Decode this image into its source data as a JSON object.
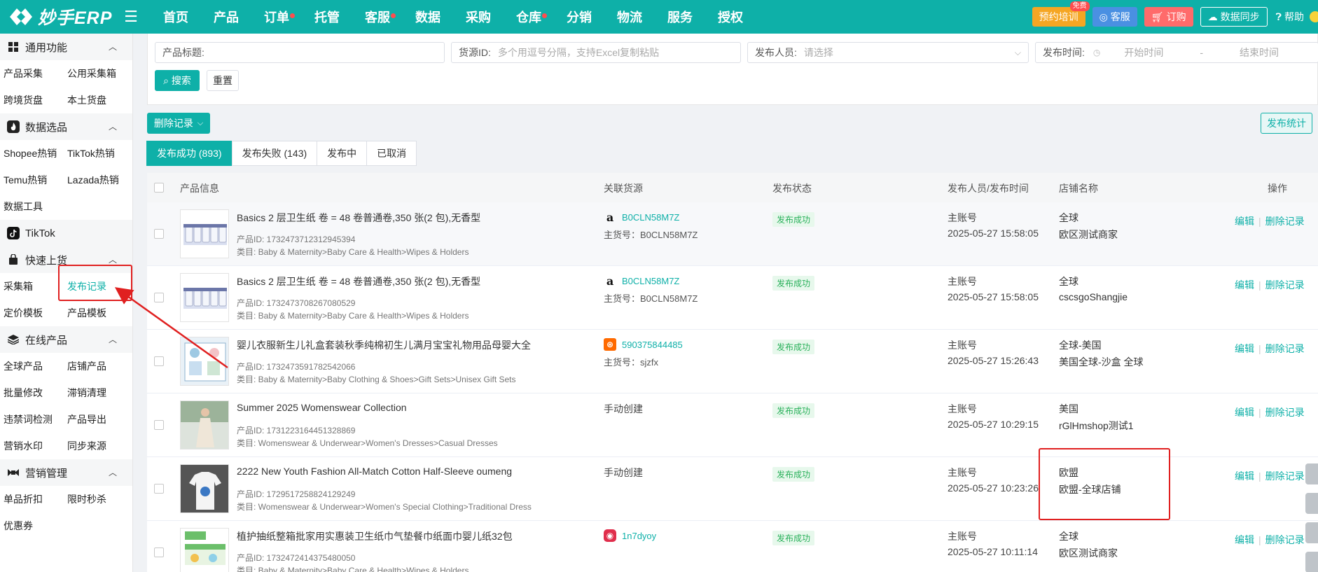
{
  "brand": {
    "logo_text": "妙手ERP"
  },
  "topnav": {
    "items": [
      {
        "label": "首页",
        "dot": false
      },
      {
        "label": "产品",
        "dot": false
      },
      {
        "label": "订单",
        "dot": true
      },
      {
        "label": "托管",
        "dot": false
      },
      {
        "label": "客服",
        "dot": true
      },
      {
        "label": "数据",
        "dot": false
      },
      {
        "label": "采购",
        "dot": false
      },
      {
        "label": "仓库",
        "dot": true
      },
      {
        "label": "分销",
        "dot": false
      },
      {
        "label": "物流",
        "dot": false
      },
      {
        "label": "服务",
        "dot": false
      },
      {
        "label": "授权",
        "dot": false
      }
    ],
    "train_label": "预约培训",
    "free_label": "免费",
    "service_label": "客服",
    "order_label": "订购",
    "sync_label": "数据同步",
    "help_label": "帮助"
  },
  "sidebar": {
    "groups": [
      {
        "title": "通用功能",
        "icon": "grid-icon",
        "rows": [
          [
            "产品采集",
            "公用采集箱"
          ],
          [
            "跨境货盘",
            "本土货盘"
          ]
        ]
      },
      {
        "title": "数据选品",
        "icon": "flame-icon",
        "rows": [
          [
            "Shopee热销",
            "TikTok热销"
          ],
          [
            "Temu热销",
            "Lazada热销"
          ],
          [
            "数据工具"
          ]
        ]
      },
      {
        "title": "TikTok",
        "icon": "tiktok-icon",
        "rows": []
      },
      {
        "title": "快速上货",
        "icon": "bag-icon",
        "rows": [
          [
            "采集箱",
            "发布记录"
          ],
          [
            "定价模板",
            "产品模板"
          ]
        ]
      },
      {
        "title": "在线产品",
        "icon": "stack-icon",
        "rows": [
          [
            "全球产品",
            "店铺产品"
          ],
          [
            "批量修改",
            "滞销清理"
          ],
          [
            "违禁词检测",
            "产品导出"
          ],
          [
            "营销水印",
            "同步来源"
          ]
        ]
      },
      {
        "title": "营销管理",
        "icon": "ribbon-icon",
        "rows": [
          [
            "单品折扣",
            "限时秒杀"
          ],
          [
            "优惠券"
          ]
        ]
      }
    ],
    "active_item": "发布记录"
  },
  "search": {
    "title_label": "产品标题:",
    "source_label": "货源ID:",
    "source_placeholder": "多个用逗号分隔，支持Excel复制粘贴",
    "publisher_label": "发布人员:",
    "publisher_placeholder": "请选择",
    "time_label": "发布时间:",
    "start_placeholder": "开始时间",
    "dash": "-",
    "end_placeholder": "结束时间",
    "search_btn": "搜索",
    "reset_btn": "重置"
  },
  "actions": {
    "delete_records": "删除记录",
    "publish_stats": "发布统计"
  },
  "tabs": [
    {
      "label": "发布成功 (893)",
      "active": true
    },
    {
      "label": "发布失败 (143)",
      "active": false
    },
    {
      "label": "发布中",
      "active": false
    },
    {
      "label": "已取消",
      "active": false
    }
  ],
  "table": {
    "headers": {
      "product": "产品信息",
      "source": "关联货源",
      "status": "发布状态",
      "publisher": "发布人员/发布时间",
      "store": "店铺名称",
      "ops": "操作"
    },
    "rows": [
      {
        "title": "Basics 2 层卫生纸 卷 = 48 卷普通卷,350 张(2 包),无香型",
        "pid": "产品ID: 1732473712312945394",
        "cat": "类目: Baby & Maternity>Baby Care & Health>Wipes & Holders",
        "src_type": "amazon",
        "src_link": "B0CLN58M7Z",
        "src_main": "主货号：B0CLN58M7Z",
        "status": "发布成功",
        "publisher": "主账号",
        "time": "2025-05-27 15:58:05",
        "store1": "全球",
        "store2": "欧区测试商家",
        "thumb": "tissue"
      },
      {
        "title": "Basics 2 层卫生纸 卷 = 48 卷普通卷,350 张(2 包),无香型",
        "pid": "产品ID: 1732473708267080529",
        "cat": "类目: Baby & Maternity>Baby Care & Health>Wipes & Holders",
        "src_type": "amazon",
        "src_link": "B0CLN58M7Z",
        "src_main": "主货号：B0CLN58M7Z",
        "status": "发布成功",
        "publisher": "主账号",
        "time": "2025-05-27 15:58:05",
        "store1": "全球",
        "store2": "cscsgoShangjie",
        "thumb": "tissue"
      },
      {
        "title": "婴儿衣服新生儿礼盒套装秋季纯棉初生儿满月宝宝礼物用品母婴大全",
        "pid": "产品ID: 1732473591782542066",
        "cat": "类目: Baby & Maternity>Baby Clothing & Shoes>Gift Sets>Unisex Gift Sets",
        "src_type": "1688",
        "src_link": "590375844485",
        "src_main": "主货号：sjzfx",
        "status": "发布成功",
        "publisher": "主账号",
        "time": "2025-05-27 15:26:43",
        "store1": "全球-美国",
        "store2": "美国全球-沙盒 全球",
        "thumb": "baby"
      },
      {
        "title": "Summer 2025 Womenswear Collection",
        "pid": "产品ID: 1731223164451328869",
        "cat": "类目: Womenswear & Underwear>Women's Dresses>Casual Dresses",
        "src_type": "manual",
        "src_link": "手动创建",
        "src_main": "",
        "status": "发布成功",
        "publisher": "主账号",
        "time": "2025-05-27 10:29:15",
        "store1": "美国",
        "store2": "rGlHmshop测试1",
        "thumb": "dress"
      },
      {
        "title": "2222 New Youth Fashion All-Match Cotton Half-Sleeve oumeng",
        "pid": "产品ID: 1729517258824129249",
        "cat": "类目: Womenswear & Underwear>Women's Special Clothing>Traditional Dress",
        "src_type": "manual",
        "src_link": "手动创建",
        "src_main": "",
        "status": "发布成功",
        "publisher": "主账号",
        "time": "2025-05-27 10:23:26",
        "store1": "欧盟",
        "store2": "欧盟-全球店铺",
        "thumb": "tshirt"
      },
      {
        "title": "植护抽纸整箱批家用实惠装卫生纸巾气垫餐巾纸面巾婴儿纸32包",
        "pid": "产品ID: 1732472414375480050",
        "cat": "类目: Baby & Maternity>Baby Care & Health>Wipes & Holders",
        "src_type": "pdd",
        "src_link": "1n7dyoy",
        "src_main": "",
        "status": "发布成功",
        "publisher": "主账号",
        "time": "2025-05-27 10:11:14",
        "store1": "全球",
        "store2": "欧区测试商家",
        "thumb": "napkin"
      }
    ],
    "op_edit": "编辑",
    "op_delete": "删除记录"
  }
}
